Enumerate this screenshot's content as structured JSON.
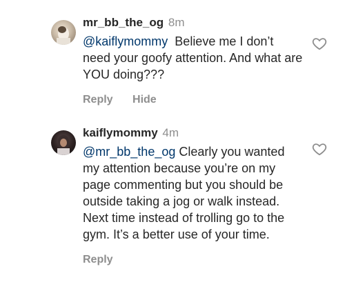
{
  "comments": [
    {
      "username": "mr_bb_the_og",
      "timestamp": "8m",
      "mention": "@kaiflymommy",
      "text": "Believe me I don’t need your goofy attention. And what are YOU doing???",
      "actions": {
        "reply": "Reply",
        "hide": "Hide"
      },
      "icons": {
        "avatar": "avatar",
        "like": "heart-icon"
      }
    },
    {
      "username": "kaiflymommy",
      "timestamp": "4m",
      "mention": "@mr_bb_the_og",
      "text": "Clearly you wanted my attention because you’re on my page commenting but you should be outside taking a jog or walk instead. Next time instead of trolling go to the gym. It’s a better use of your time.",
      "actions": {
        "reply": "Reply"
      },
      "icons": {
        "avatar": "avatar",
        "like": "heart-icon"
      }
    }
  ]
}
